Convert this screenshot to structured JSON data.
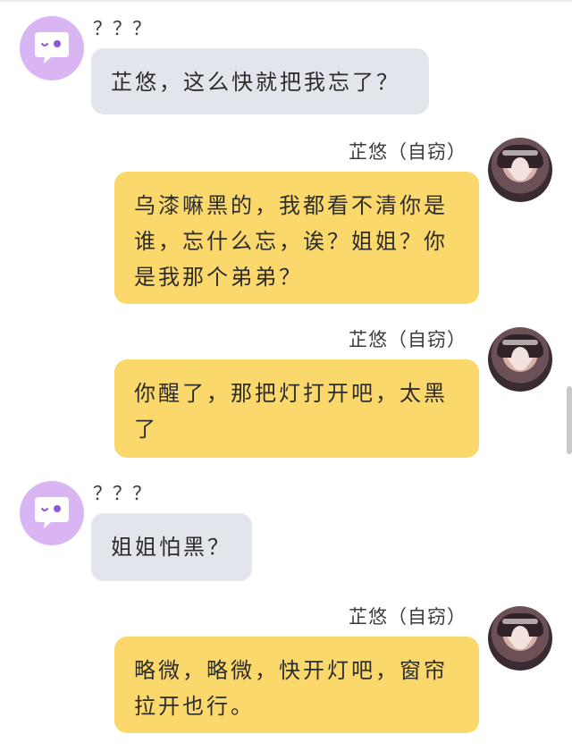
{
  "messages": [
    {
      "side": "left",
      "sender": "？？？",
      "text": "芷悠，这么快就把我忘了？"
    },
    {
      "side": "right",
      "sender": "芷悠（自窃）",
      "text": "乌漆嘛黑的，我都看不清你是谁，忘什么忘，诶？姐姐？你是我那个弟弟？"
    },
    {
      "side": "right",
      "sender": "芷悠（自窃）",
      "text": "你醒了，那把灯打开吧，太黑了"
    },
    {
      "side": "left",
      "sender": "？？？",
      "text": "姐姐怕黑？"
    },
    {
      "side": "right",
      "sender": "芷悠（自窃）",
      "text": "略微，略微，快开灯吧，窗帘拉开也行。"
    }
  ],
  "colors": {
    "left_bubble": "#e2e5ec",
    "right_bubble": "#fbd86c",
    "left_avatar": "#d9b6f3",
    "left_avatar_icon": "#8b57d8"
  },
  "icons": {
    "left_avatar": "chat-bubble-icon",
    "right_avatar": "portrait-avatar"
  }
}
